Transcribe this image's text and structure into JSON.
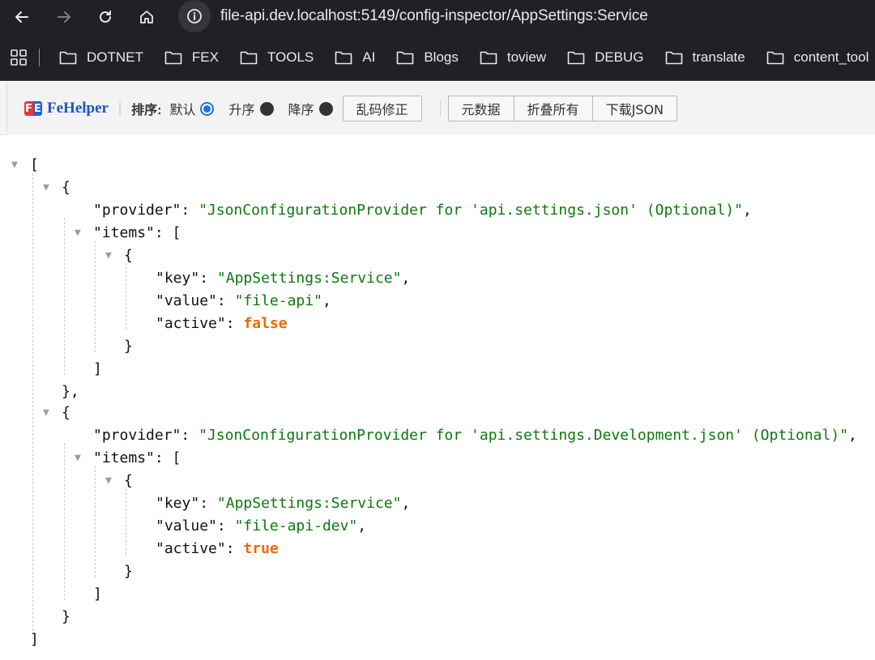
{
  "browser": {
    "url": "file-api.dev.localhost:5149/config-inspector/AppSettings:Service",
    "bookmarks": [
      "DOTNET",
      "FEX",
      "TOOLS",
      "AI",
      "Blogs",
      "toview",
      "DEBUG",
      "translate",
      "content_tool"
    ]
  },
  "fehelper": {
    "logo_badge_left": "F",
    "logo_badge_right": "E",
    "name": "FeHelper",
    "sort_label": "排序:",
    "sort_options": [
      "默认",
      "升序",
      "降序"
    ],
    "sort_selected": "默认",
    "fix_button": "乱码修正",
    "buttons": [
      "元数据",
      "折叠所有",
      "下载JSON"
    ]
  },
  "json": {
    "entries": [
      {
        "provider": "JsonConfigurationProvider for 'api.settings.json' (Optional)",
        "items": [
          {
            "key": "AppSettings:Service",
            "value": "file-api",
            "active": "false"
          }
        ]
      },
      {
        "provider": "JsonConfigurationProvider for 'api.settings.Development.json' (Optional)",
        "items": [
          {
            "key": "AppSettings:Service",
            "value": "file-api-dev",
            "active": "true"
          }
        ]
      }
    ],
    "keys": {
      "provider": "provider",
      "items": "items",
      "key": "key",
      "value": "value",
      "active": "active"
    }
  },
  "colors": {
    "string": "#0b7a0b",
    "boolean": "#ef6a00",
    "chrome_bg": "#202124",
    "accent": "#1a73e8"
  },
  "icons": [
    "back-arrow-icon",
    "forward-arrow-icon",
    "reload-icon",
    "home-icon",
    "info-icon",
    "apps-grid-icon",
    "folder-icon",
    "radio-icon",
    "expand-triangle-icon"
  ]
}
